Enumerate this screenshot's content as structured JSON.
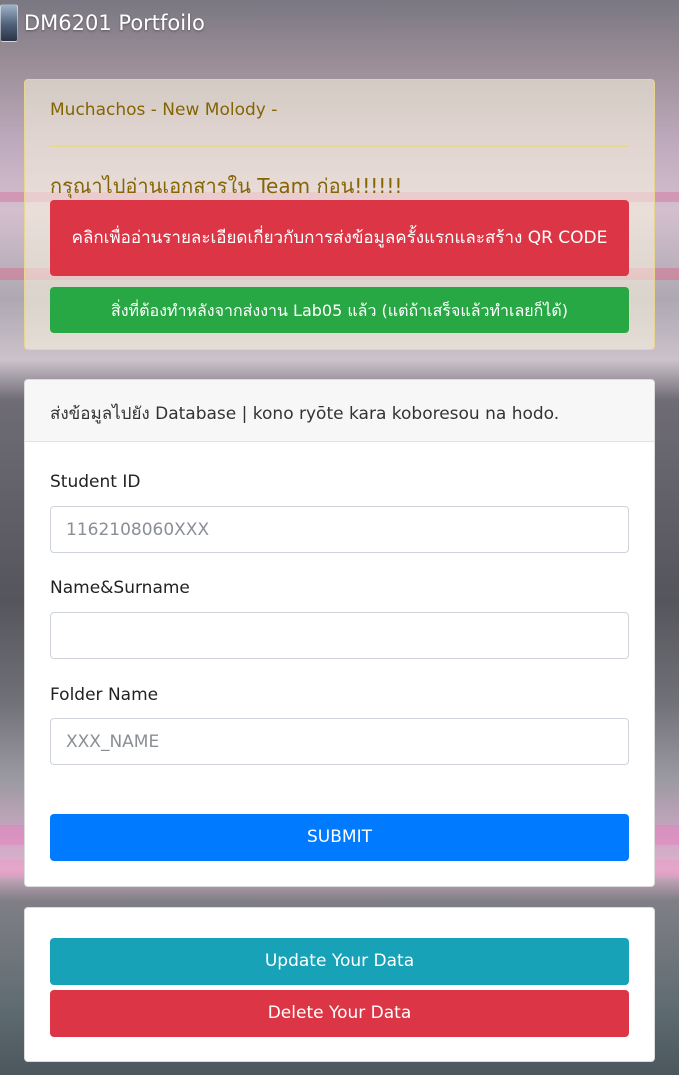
{
  "app": {
    "brand": "DM6201 Portfoilo"
  },
  "notice": {
    "song": "Muchachos - New Molody -",
    "title": "กรุณาไปอ่านเอกสารใน Team ก่อน!!!!!!",
    "btn_first_submit": "คลิกเพื่ออ่านรายละเอียดเกี่ยวกับการส่งข้อมูลครั้งแรกและสร้าง QR CODE",
    "btn_after_lab": "สิ่งที่ต้องทำหลังจากส่งงาน Lab05 แล้ว (แต่ถ้าเสร็จแล้วทำเลยก็ได้)"
  },
  "form": {
    "header": "ส่งข้อมูลไปยัง Database | kono ryōte kara koboresou na hodo.",
    "student_id_label": "Student ID",
    "student_id_placeholder": "1162108060XXX",
    "name_label": "Name&Surname",
    "name_placeholder": "",
    "folder_label": "Folder Name",
    "folder_placeholder": "XXX_NAME",
    "submit_label": "SUBMIT"
  },
  "actions": {
    "update_label": "Update Your Data",
    "delete_label": "Delete Your Data"
  },
  "colors": {
    "danger": "#dc3545",
    "success": "#28a745",
    "primary": "#007bff",
    "info": "#17a2b8",
    "warning_text": "#856404"
  }
}
